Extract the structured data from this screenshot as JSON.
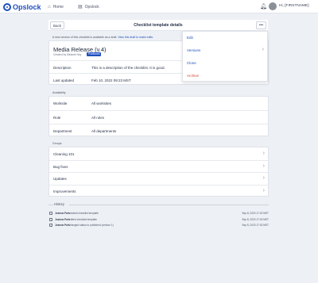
{
  "app": {
    "name": "Opslock"
  },
  "topnav": {
    "items": [
      {
        "label": "Home",
        "icon": "home-icon"
      },
      {
        "label": "Opslock",
        "icon": "document-icon"
      }
    ],
    "user_name": "Hi, [FIRSTNAME]"
  },
  "header": {
    "back_label": "Back",
    "title": "Checklist template details",
    "more_label": "•••"
  },
  "draft_notice": {
    "text": "A new version of this checklist is available as a draft.",
    "link": "View this draft to make edits."
  },
  "checklist": {
    "title": "Media Release (v.4)",
    "created_by": "Created by Melanie Ney",
    "status": "Published",
    "description_label": "Description",
    "description": "This is a description of the checklist. It is good.",
    "last_updated_label": "Last updated",
    "last_updated": "Feb 10, 2022 09:23 MST"
  },
  "availability": {
    "section_label": "Availability",
    "rows": [
      {
        "label": "Worksite",
        "value": "All worksites"
      },
      {
        "label": "Role",
        "value": "All roles"
      },
      {
        "label": "Department",
        "value": "All departments"
      }
    ]
  },
  "groups": {
    "section_label": "Groups",
    "items": [
      {
        "label": "Cleaning 101"
      },
      {
        "label": "Bug fixes"
      },
      {
        "label": "Updates"
      },
      {
        "label": "Improvements"
      }
    ]
  },
  "history": {
    "label": "History",
    "items": [
      {
        "user": "Joanna Park",
        "action": "created checklist template",
        "time": "Sep 8, 2020 17:02 MST"
      },
      {
        "user": "Joanna Park",
        "action": "edited checklist template",
        "time": "Sep 8, 2020 17:02 MST"
      },
      {
        "user": "Joanna Park",
        "action": "changed status to published (version 1)",
        "time": "Sep 8, 2020 17:02 MST"
      }
    ]
  },
  "menu": {
    "items": [
      {
        "label": "Edit"
      },
      {
        "label": "Versions"
      },
      {
        "label": "Clone"
      },
      {
        "label": "Archive"
      }
    ]
  },
  "colors": {
    "brand": "#1f4fbf",
    "danger": "#d2452f",
    "background": "#edf0f4"
  }
}
